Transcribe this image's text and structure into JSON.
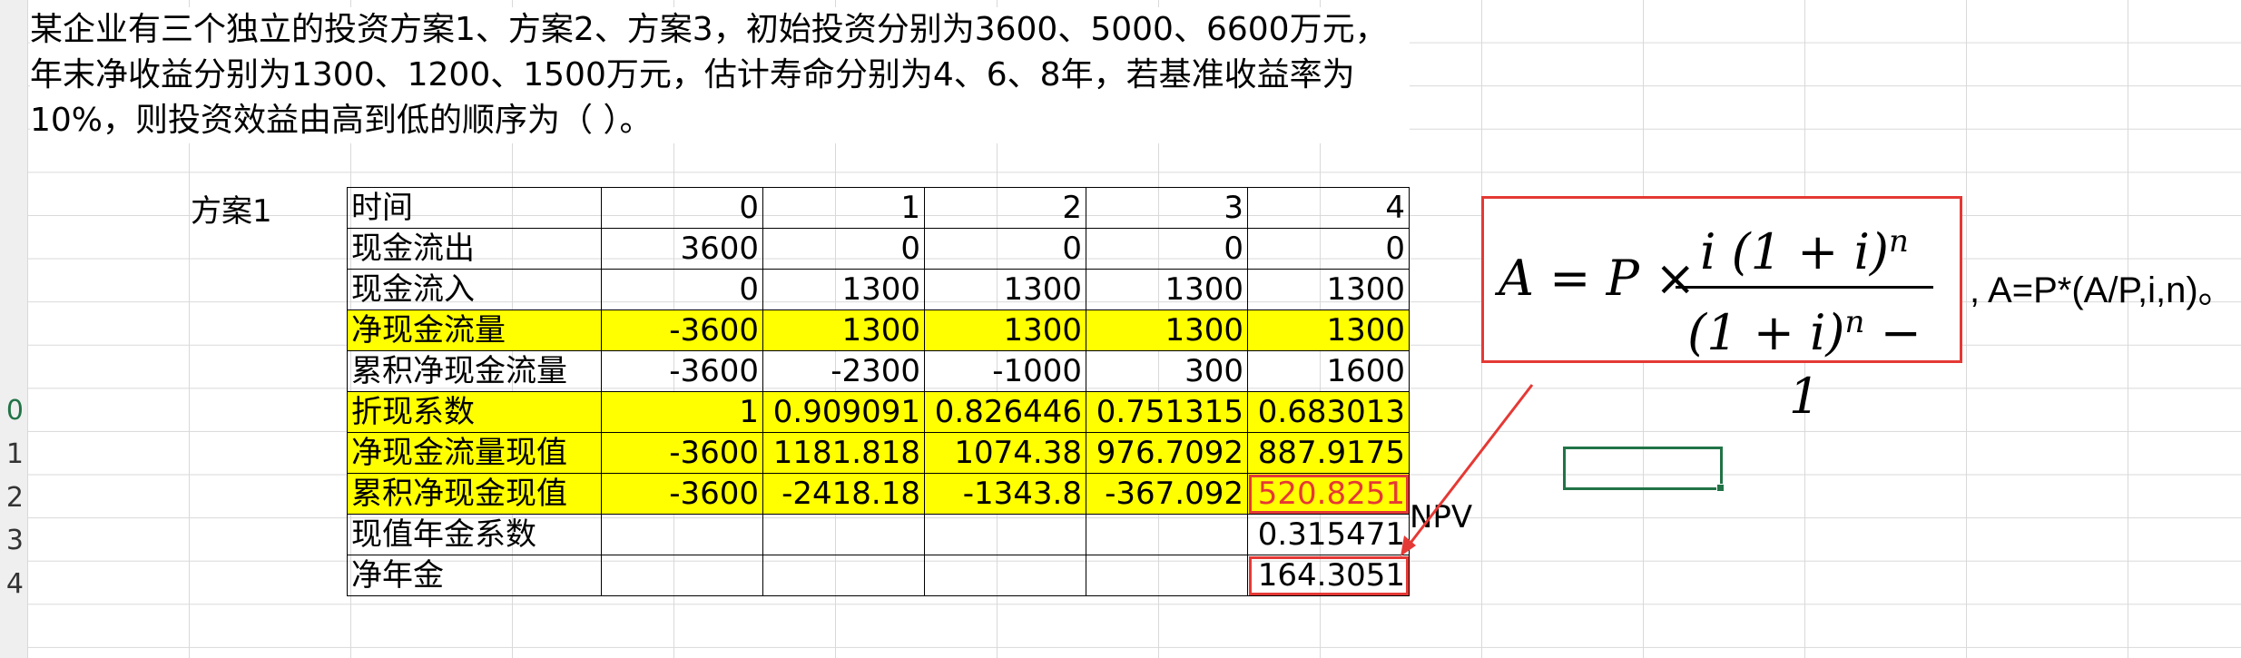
{
  "question": "某企业有三个独立的投资方案1、方案2、方案3，初始投资分别为3600、5000、6600万元，年末净收益分别为1300、1200、1500万元，估计寿命分别为4、6、8年，若基准收益率为10%，则投资效益由高到低的顺序为（ ）。",
  "plan_label": "方案1",
  "row_numbers": [
    "",
    "",
    "",
    "",
    "",
    "",
    "",
    "",
    "",
    "0",
    "1",
    "2",
    "3",
    "4"
  ],
  "table": {
    "rows": [
      {
        "label": "时间",
        "values": [
          "0",
          "1",
          "2",
          "3",
          "4"
        ],
        "highlight": false
      },
      {
        "label": "现金流出",
        "values": [
          "3600",
          "0",
          "0",
          "0",
          "0"
        ],
        "highlight": false
      },
      {
        "label": "现金流入",
        "values": [
          "0",
          "1300",
          "1300",
          "1300",
          "1300"
        ],
        "highlight": false
      },
      {
        "label": "净现金流量",
        "values": [
          "-3600",
          "1300",
          "1300",
          "1300",
          "1300"
        ],
        "highlight": true
      },
      {
        "label": "累积净现金流量",
        "values": [
          "-3600",
          "-2300",
          "-1000",
          "300",
          "1600"
        ],
        "highlight": false
      },
      {
        "label": "折现系数",
        "values": [
          "1",
          "0.909091",
          "0.826446",
          "0.751315",
          "0.683013"
        ],
        "highlight": true
      },
      {
        "label": "净现金流量现值",
        "values": [
          "-3600",
          "1181.818",
          "1074.38",
          "976.7092",
          "887.9175"
        ],
        "highlight": true
      },
      {
        "label": "累积净现金现值",
        "values": [
          "-3600",
          "-2418.18",
          "-1343.8",
          "-367.092",
          "520.8251"
        ],
        "highlight": true
      },
      {
        "label": "现值年金系数",
        "values": [
          "",
          "",
          "",
          "",
          "0.315471"
        ],
        "highlight": false
      },
      {
        "label": "净年金",
        "values": [
          "",
          "",
          "",
          "",
          "164.3051"
        ],
        "highlight": false
      }
    ]
  },
  "npv_label": "NPV",
  "formula": {
    "lhs": "A = P ×",
    "numerator": "i (1 + i)",
    "denominator": "(1 + i)",
    "exponent": "n",
    "denominator_tail": " − 1",
    "comma": ",",
    "text": "A=P*(A/P,i,n)。"
  },
  "colors": {
    "highlight": "#ffff00",
    "annotation_red": "#e53935",
    "selection_green": "#217346"
  }
}
